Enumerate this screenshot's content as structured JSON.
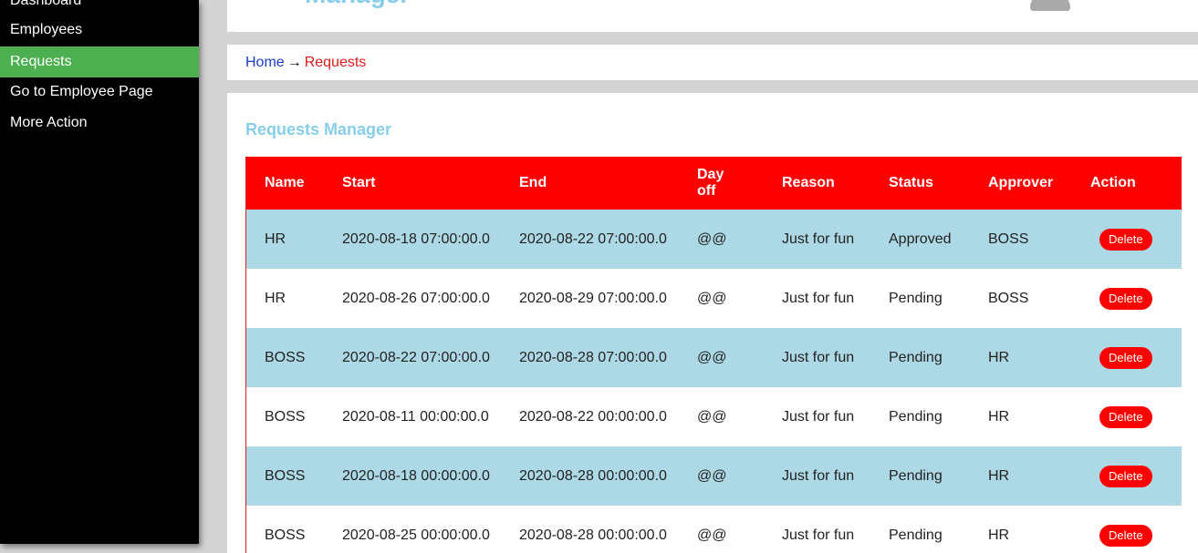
{
  "sidebar": {
    "items": [
      {
        "label": "Dashboard",
        "active": false
      },
      {
        "label": "Employees",
        "active": false
      },
      {
        "label": "Requests",
        "active": true
      },
      {
        "label": "Go to Employee Page",
        "active": false
      },
      {
        "label": "More Action",
        "active": false
      }
    ],
    "active_color": "#4caf50"
  },
  "header": {
    "title_fragment": "Manager"
  },
  "breadcrumb": {
    "home": "Home",
    "separator": "→",
    "current": "Requests"
  },
  "main": {
    "section_title": "Requests Manager",
    "table": {
      "header_color": "#ff0000",
      "columns": [
        "Name",
        "Start",
        "End",
        "Day off",
        "Reason",
        "Status",
        "Approver",
        "Action"
      ],
      "rows": [
        {
          "name": "HR",
          "start": "2020-08-18 07:00:00.0",
          "end": "2020-08-22 07:00:00.0",
          "dayoff": "@@",
          "reason": "Just for fun",
          "status": "Approved",
          "approver": "BOSS",
          "action": "Delete"
        },
        {
          "name": "HR",
          "start": "2020-08-26 07:00:00.0",
          "end": "2020-08-29 07:00:00.0",
          "dayoff": "@@",
          "reason": "Just for fun",
          "status": "Pending",
          "approver": "BOSS",
          "action": "Delete"
        },
        {
          "name": "BOSS",
          "start": "2020-08-22 07:00:00.0",
          "end": "2020-08-28 07:00:00.0",
          "dayoff": "@@",
          "reason": "Just for fun",
          "status": "Pending",
          "approver": "HR",
          "action": "Delete"
        },
        {
          "name": "BOSS",
          "start": "2020-08-11 00:00:00.0",
          "end": "2020-08-22 00:00:00.0",
          "dayoff": "@@",
          "reason": "Just for fun",
          "status": "Pending",
          "approver": "HR",
          "action": "Delete"
        },
        {
          "name": "BOSS",
          "start": "2020-08-18 00:00:00.0",
          "end": "2020-08-28 00:00:00.0",
          "dayoff": "@@",
          "reason": "Just for fun",
          "status": "Pending",
          "approver": "HR",
          "action": "Delete"
        },
        {
          "name": "BOSS",
          "start": "2020-08-25 00:00:00.0",
          "end": "2020-08-28 00:00:00.0",
          "dayoff": "@@",
          "reason": "Just for fun",
          "status": "Pending",
          "approver": "HR",
          "action": "Delete"
        }
      ]
    }
  }
}
